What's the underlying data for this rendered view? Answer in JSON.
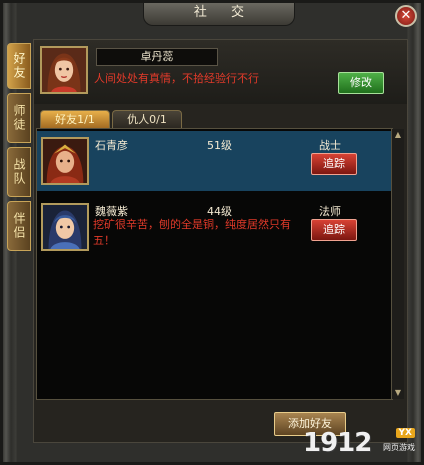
{
  "window": {
    "title": "社 交",
    "close_glyph": "✕"
  },
  "side_tabs": [
    {
      "label": "好友",
      "active": true
    },
    {
      "label": "师徒",
      "active": false
    },
    {
      "label": "战队",
      "active": false
    },
    {
      "label": "伴侣",
      "active": false
    }
  ],
  "profile": {
    "name": "卓丹蕊",
    "signature": "人间处处有真情，不拾经验行不行",
    "edit_label": "修改"
  },
  "relation_tabs": [
    {
      "label": "好友1/1",
      "active": true
    },
    {
      "label": "仇人0/1",
      "active": false
    }
  ],
  "friends": [
    {
      "name": "石青彦",
      "level": "51级",
      "class": "战士",
      "signature": "",
      "track_label": "追踪",
      "selected": true
    },
    {
      "name": "魏薇紫",
      "level": "44级",
      "class": "法师",
      "signature": "挖矿很辛苦，刨的全是铜，纯度居然只有五！",
      "track_label": "追踪",
      "selected": false
    }
  ],
  "add_friend_label": "添加好友",
  "watermark": {
    "number": "1912",
    "badge": "YX",
    "site": "网页游戏"
  },
  "colors": {
    "signature_red": "#e23a2a",
    "selected_row": "#18435e",
    "tab_gold": "#e8b04a"
  }
}
